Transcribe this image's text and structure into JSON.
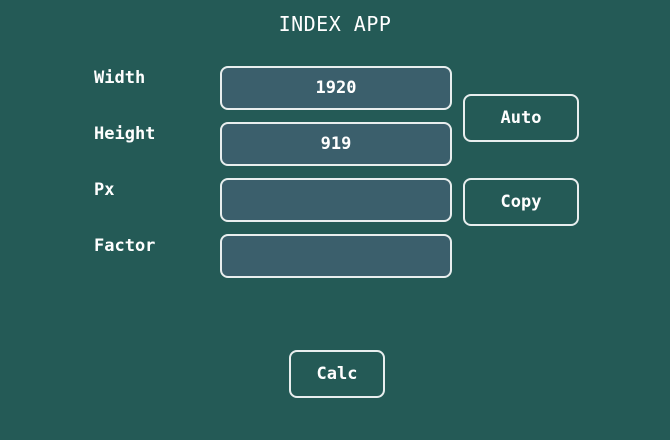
{
  "app": {
    "title": "INDEX APP"
  },
  "form": {
    "width_label": "Width",
    "width_value": "1920",
    "height_label": "Height",
    "height_value": "919",
    "px_label": "Px",
    "px_value": "",
    "factor_label": "Factor",
    "factor_value": ""
  },
  "buttons": {
    "auto": "Auto",
    "copy": "Copy",
    "calc": "Calc"
  },
  "colors": {
    "background": "#245a56",
    "field_fill": "#3b5f6c",
    "border": "#e8eeee",
    "text": "#ffffff"
  }
}
